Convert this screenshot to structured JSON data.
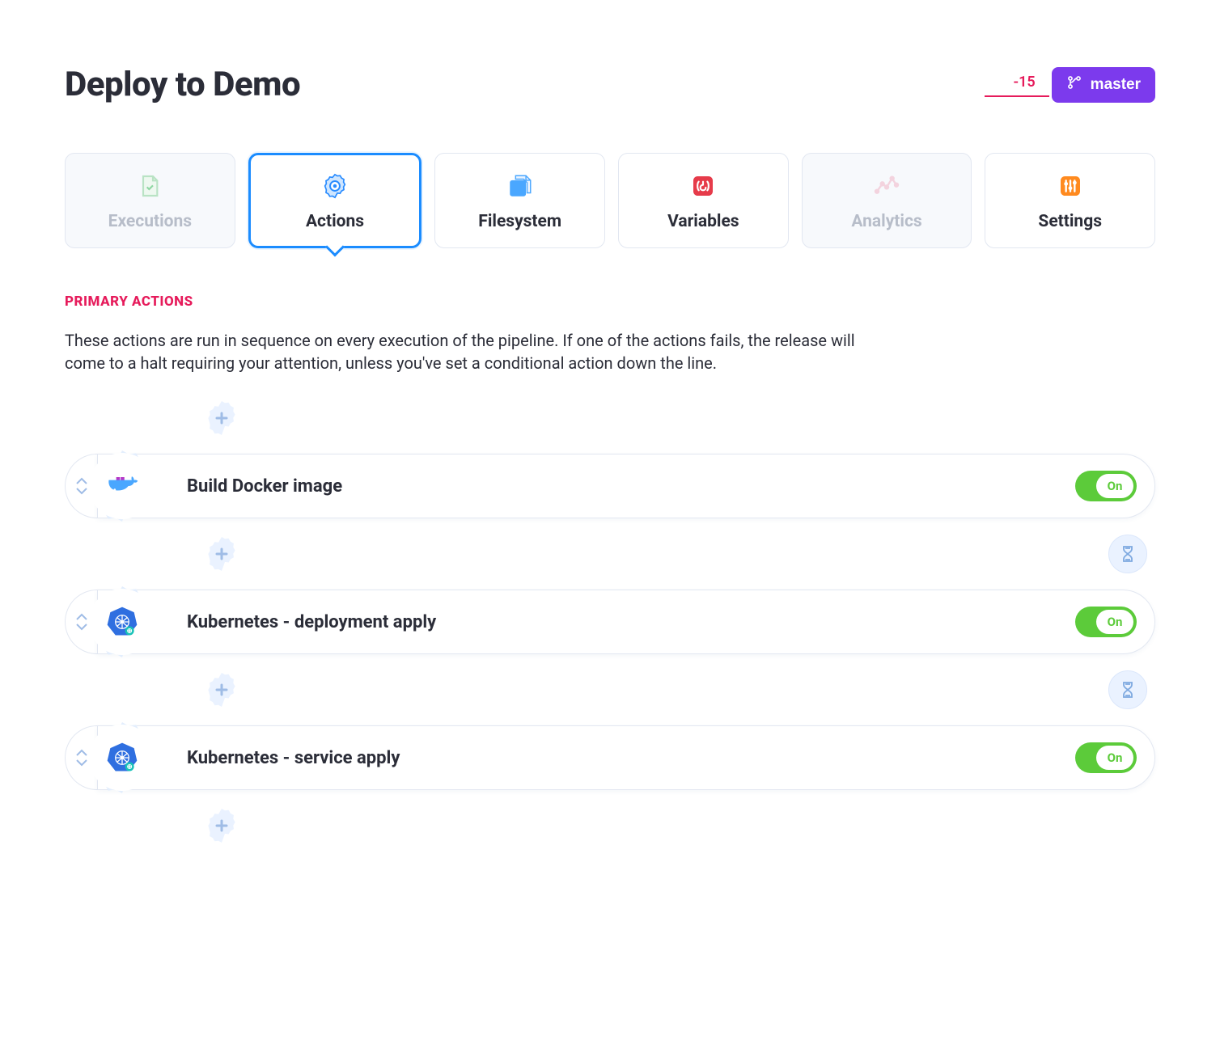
{
  "header": {
    "title": "Deploy to Demo",
    "runs_label": "-15",
    "branch_label": "master"
  },
  "tabs": [
    {
      "label": "Executions",
      "state": "muted"
    },
    {
      "label": "Actions",
      "state": "active"
    },
    {
      "label": "Filesystem",
      "state": "normal"
    },
    {
      "label": "Variables",
      "state": "normal"
    },
    {
      "label": "Analytics",
      "state": "muted"
    },
    {
      "label": "Settings",
      "state": "normal"
    }
  ],
  "section": {
    "heading": "PRIMARY ACTIONS",
    "description": "These actions are run in sequence on every execution of the pipeline. If one of the actions fails, the release will come to a halt requiring your attention, unless you've set a conditional action down the line."
  },
  "actions": [
    {
      "title": "Build Docker image",
      "icon": "docker",
      "toggle": "On"
    },
    {
      "title": "Kubernetes - deployment apply",
      "icon": "kubernetes",
      "toggle": "On"
    },
    {
      "title": "Kubernetes - service apply",
      "icon": "kubernetes",
      "toggle": "On"
    }
  ],
  "icons": {
    "add": "+",
    "toggle_on": "On"
  }
}
